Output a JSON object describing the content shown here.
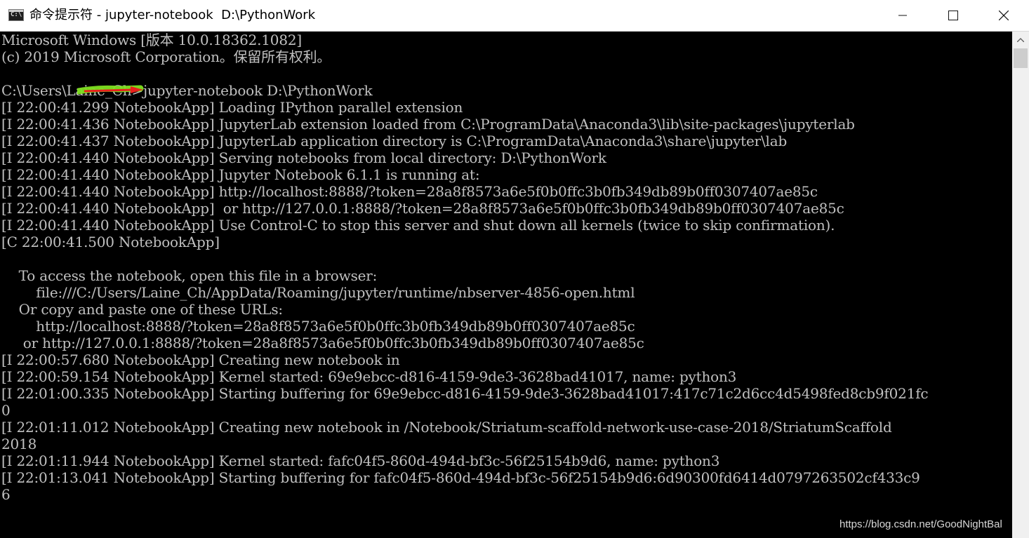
{
  "window": {
    "title": "命令提示符 - jupyter-notebook  D:\\PythonWork",
    "icon": "cmd-icon",
    "icon_text": "C:\\",
    "controls": {
      "minimize": "minimize-icon",
      "maximize": "maximize-icon",
      "close": "close-icon"
    }
  },
  "console": {
    "background": "#000000",
    "foreground": "#c0c0c0",
    "lines": [
      "Microsoft Windows [版本 10.0.18362.1082]",
      "(c) 2019 Microsoft Corporation。保留所有权利。",
      "",
      "C:\\Users\\Laine_Ch>jupyter-notebook D:\\PythonWork",
      "[I 22:00:41.299 NotebookApp] Loading IPython parallel extension",
      "[I 22:00:41.436 NotebookApp] JupyterLab extension loaded from C:\\ProgramData\\Anaconda3\\lib\\site-packages\\jupyterlab",
      "[I 22:00:41.437 NotebookApp] JupyterLab application directory is C:\\ProgramData\\Anaconda3\\share\\jupyter\\lab",
      "[I 22:00:41.440 NotebookApp] Serving notebooks from local directory: D:\\PythonWork",
      "[I 22:00:41.440 NotebookApp] Jupyter Notebook 6.1.1 is running at:",
      "[I 22:00:41.440 NotebookApp] http://localhost:8888/?token=28a8f8573a6e5f0b0ffc3b0fb349db89b0ff0307407ae85c",
      "[I 22:00:41.440 NotebookApp]  or http://127.0.0.1:8888/?token=28a8f8573a6e5f0b0ffc3b0fb349db89b0ff0307407ae85c",
      "[I 22:00:41.440 NotebookApp] Use Control-C to stop this server and shut down all kernels (twice to skip confirmation).",
      "[C 22:00:41.500 NotebookApp]",
      "",
      "    To access the notebook, open this file in a browser:",
      "        file:///C:/Users/Laine_Ch/AppData/Roaming/jupyter/runtime/nbserver-4856-open.html",
      "    Or copy and paste one of these URLs:",
      "        http://localhost:8888/?token=28a8f8573a6e5f0b0ffc3b0fb349db89b0ff0307407ae85c",
      "     or http://127.0.0.1:8888/?token=28a8f8573a6e5f0b0ffc3b0fb349db89b0ff0307407ae85c",
      "[I 22:00:57.680 NotebookApp] Creating new notebook in",
      "[I 22:00:59.154 NotebookApp] Kernel started: 69e9ebcc-d816-4159-9de3-3628bad41017, name: python3",
      "[I 22:01:00.335 NotebookApp] Starting buffering for 69e9ebcc-d816-4159-9de3-3628bad41017:417c71c2d6cc4d5498fed8cb9f021fc",
      "0",
      "[I 22:01:11.012 NotebookApp] Creating new notebook in /Notebook/Striatum-scaffold-network-use-case-2018/StriatumScaffold",
      "2018",
      "[I 22:01:11.944 NotebookApp] Kernel started: fafc04f5-860d-494d-bf3c-56f25154b9d6, name: python3",
      "[I 22:01:13.041 NotebookApp] Starting buffering for fafc04f5-860d-494d-bf3c-56f25154b9d6:6d90300fd6414d0797263502cf433c9",
      "6"
    ]
  },
  "scrollbar": {
    "up_arrow": "scroll-up-arrow-icon"
  },
  "watermark": "https://blog.csdn.net/GoodNightBal",
  "annotation": {
    "icon": "arrow-annotation-icon",
    "colors": {
      "highlight": "#7fe020",
      "arrow": "#e8201c"
    }
  }
}
